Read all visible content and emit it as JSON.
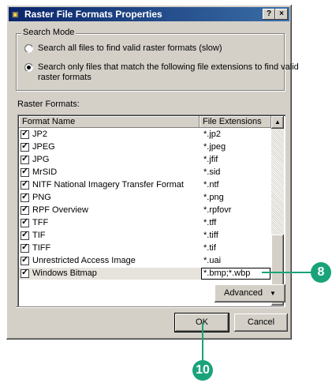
{
  "window": {
    "title": "Raster File Formats Properties",
    "help_label": "?",
    "close_label": "×"
  },
  "search_mode": {
    "title": "Search Mode",
    "options": [
      {
        "label": "Search all files to find valid raster formats (slow)",
        "selected": false
      },
      {
        "label": "Search only files that match the following file extensions to find valid",
        "label_line2": "raster formats",
        "selected": true
      }
    ]
  },
  "raster_formats": {
    "label": "Raster Formats:",
    "columns": [
      "Format Name",
      "File Extensions"
    ],
    "rows": [
      {
        "name": "JP2",
        "ext": "*.jp2",
        "checked": true
      },
      {
        "name": "JPEG",
        "ext": "*.jpeg",
        "checked": true
      },
      {
        "name": "JPG",
        "ext": "*.jfif",
        "checked": true
      },
      {
        "name": "MrSID",
        "ext": "*.sid",
        "checked": true
      },
      {
        "name": "NITF National Imagery Transfer Format",
        "ext": "*.ntf",
        "checked": true
      },
      {
        "name": "PNG",
        "ext": "*.png",
        "checked": true
      },
      {
        "name": "RPF Overview",
        "ext": "*.rpfovr",
        "checked": true
      },
      {
        "name": "TFF",
        "ext": "*.tff",
        "checked": true
      },
      {
        "name": "TIF",
        "ext": "*.tiff",
        "checked": true
      },
      {
        "name": "TIFF",
        "ext": "*.tif",
        "checked": true
      },
      {
        "name": "Unrestricted Access Image",
        "ext": "*.uai",
        "checked": true
      },
      {
        "name": "Windows Bitmap",
        "ext": "*.bmp;*.wbp",
        "checked": true,
        "editing": true
      }
    ]
  },
  "buttons": {
    "advanced": "Advanced",
    "ok": "OK",
    "cancel": "Cancel"
  },
  "callouts": {
    "edit_step": "8",
    "ok_step": "10"
  },
  "colors": {
    "callout": "#1aa37a",
    "titlebar": "#0a246a"
  }
}
